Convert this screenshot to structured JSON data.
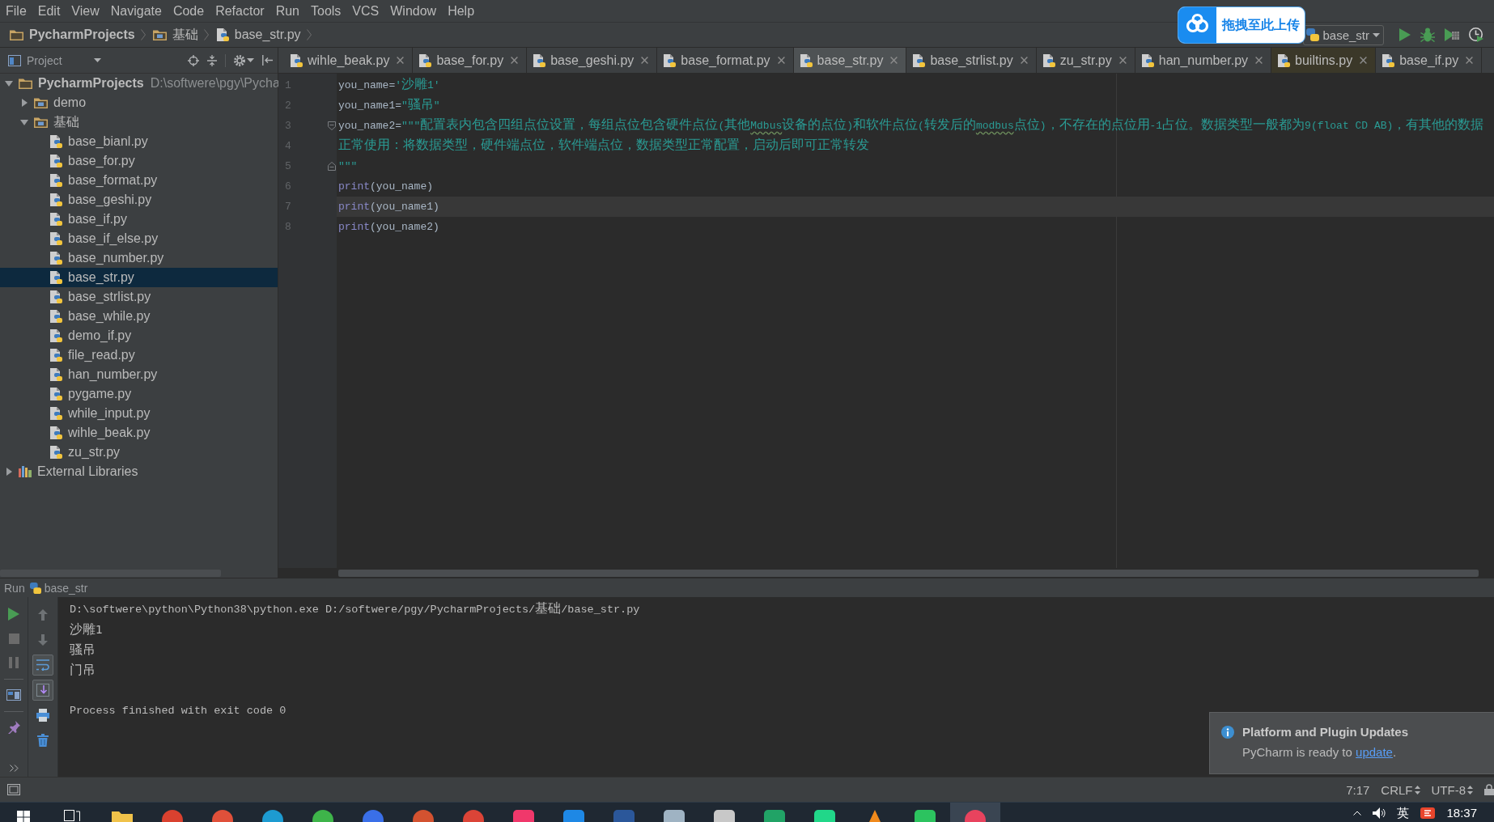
{
  "menu_bar": {
    "items": [
      "File",
      "Edit",
      "View",
      "Navigate",
      "Code",
      "Refactor",
      "Run",
      "Tools",
      "VCS",
      "Window",
      "Help"
    ]
  },
  "nav_bar": {
    "breadcrumbs": [
      {
        "label": "PycharmProjects",
        "kind": "project"
      },
      {
        "label": "基础",
        "kind": "folder"
      },
      {
        "label": "base_str.py",
        "kind": "file"
      }
    ],
    "run_config": "base_str"
  },
  "upload_widget": {
    "label": "拖拽至此上传"
  },
  "project_panel": {
    "title": "Project",
    "tree": [
      {
        "label": "PycharmProjects",
        "path": "D:\\softwere\\pgy\\Pycha",
        "kind": "project",
        "expanded": true,
        "selected": false,
        "children": [
          {
            "label": "demo",
            "kind": "folder",
            "expanded": false,
            "selected": false
          },
          {
            "label": "基础",
            "kind": "folder",
            "expanded": true,
            "selected": false,
            "children": [
              {
                "label": "base_bianl.py",
                "kind": "file",
                "selected": false
              },
              {
                "label": "base_for.py",
                "kind": "file",
                "selected": false
              },
              {
                "label": "base_format.py",
                "kind": "file",
                "selected": false
              },
              {
                "label": "base_geshi.py",
                "kind": "file",
                "selected": false
              },
              {
                "label": "base_if.py",
                "kind": "file",
                "selected": false
              },
              {
                "label": "base_if_else.py",
                "kind": "file",
                "selected": false
              },
              {
                "label": "base_number.py",
                "kind": "file",
                "selected": false
              },
              {
                "label": "base_str.py",
                "kind": "file",
                "selected": true
              },
              {
                "label": "base_strlist.py",
                "kind": "file",
                "selected": false
              },
              {
                "label": "base_while.py",
                "kind": "file",
                "selected": false
              },
              {
                "label": "demo_if.py",
                "kind": "file",
                "selected": false
              },
              {
                "label": "file_read.py",
                "kind": "file",
                "selected": false
              },
              {
                "label": "han_number.py",
                "kind": "file",
                "selected": false
              },
              {
                "label": "pygame.py",
                "kind": "file",
                "selected": false
              },
              {
                "label": "while_input.py",
                "kind": "file",
                "selected": false
              },
              {
                "label": "wihle_beak.py",
                "kind": "file",
                "selected": false
              },
              {
                "label": "zu_str.py",
                "kind": "file",
                "selected": false
              }
            ]
          }
        ]
      },
      {
        "label": "External Libraries",
        "kind": "library",
        "expanded": false,
        "selected": false
      }
    ]
  },
  "editor": {
    "tabs": [
      {
        "label": "wihle_beak.py",
        "kind": "project",
        "selected": false
      },
      {
        "label": "base_for.py",
        "kind": "project",
        "selected": false
      },
      {
        "label": "base_geshi.py",
        "kind": "project",
        "selected": false
      },
      {
        "label": "base_format.py",
        "kind": "project",
        "selected": false
      },
      {
        "label": "base_str.py",
        "kind": "project",
        "selected": true
      },
      {
        "label": "base_strlist.py",
        "kind": "project",
        "selected": false
      },
      {
        "label": "zu_str.py",
        "kind": "project",
        "selected": false
      },
      {
        "label": "han_number.py",
        "kind": "project",
        "selected": false
      },
      {
        "label": "builtins.py",
        "kind": "library",
        "selected": false
      },
      {
        "label": "base_if.py",
        "kind": "project",
        "selected": false
      }
    ],
    "lines": [
      {
        "number": "1",
        "current": false,
        "fold_start": false,
        "fold_end": false,
        "tokens": [
          {
            "text": "you_name=",
            "kind": "plain"
          },
          {
            "text": "'沙雕1'",
            "kind": "string"
          }
        ]
      },
      {
        "number": "2",
        "current": false,
        "fold_start": false,
        "fold_end": false,
        "tokens": [
          {
            "text": "you_name1=",
            "kind": "plain"
          },
          {
            "text": "\"骚吊\"",
            "kind": "string"
          }
        ]
      },
      {
        "number": "3",
        "current": false,
        "fold_start": true,
        "fold_end": false,
        "tokens": [
          {
            "text": "you_name2=",
            "kind": "plain"
          },
          {
            "text": "\"\"\"配置表内包含四组点位设置，每组点位包含硬件点位(其他",
            "kind": "string"
          },
          {
            "text": "Mdbus",
            "kind": "typo"
          },
          {
            "text": "设备的点位)和软件点位(转发后的",
            "kind": "string"
          },
          {
            "text": "modbus",
            "kind": "typo"
          },
          {
            "text": "点位)，不存在的点位用-1占位。数据类型一般都为9(float CD AB)，有其他的数据",
            "kind": "string"
          }
        ]
      },
      {
        "number": "4",
        "current": false,
        "fold_start": false,
        "fold_end": false,
        "tokens": [
          {
            "text": "正常使用：将数据类型，硬件端点位，软件端点位，数据类型正常配置，启动后即可正常转发",
            "kind": "string"
          }
        ]
      },
      {
        "number": "5",
        "current": false,
        "fold_start": false,
        "fold_end": true,
        "tokens": [
          {
            "text": "\"\"\"",
            "kind": "string"
          }
        ]
      },
      {
        "number": "6",
        "current": false,
        "fold_start": false,
        "fold_end": false,
        "tokens": [
          {
            "text": "print",
            "kind": "builtin"
          },
          {
            "text": "(you_name)",
            "kind": "plain"
          }
        ]
      },
      {
        "number": "7",
        "current": true,
        "fold_start": false,
        "fold_end": false,
        "tokens": [
          {
            "text": "print",
            "kind": "builtin"
          },
          {
            "text": "(you_name1)",
            "kind": "plain"
          }
        ]
      },
      {
        "number": "8",
        "current": false,
        "fold_start": false,
        "fold_end": false,
        "tokens": [
          {
            "text": "print",
            "kind": "builtin"
          },
          {
            "text": "(you_name2)",
            "kind": "plain"
          }
        ]
      }
    ]
  },
  "run_panel": {
    "title": "Run",
    "config": "base_str",
    "toolbar": {
      "stop_enabled": false,
      "pause_enabled": false,
      "soft_wrap": true,
      "scroll_to_end": true
    },
    "console": [
      {
        "text": "D:\\softwere\\python\\Python38\\python.exe D:/softwere/pgy/PycharmProjects/基础/base_str.py",
        "kind": "command"
      },
      {
        "text": "沙雕1",
        "kind": "output"
      },
      {
        "text": "骚吊",
        "kind": "output"
      },
      {
        "text": "门吊",
        "kind": "output"
      },
      {
        "text": "Process finished with exit code 0",
        "kind": "exit"
      }
    ]
  },
  "notification": {
    "title": "Platform and Plugin Updates",
    "text": "PyCharm is ready to",
    "link": "update",
    "end": "."
  },
  "status_bar": {
    "position": "7:17",
    "line_separator": "CRLF",
    "encoding": "UTF-8"
  },
  "taskbar": {
    "apps": [
      {
        "active": false
      },
      {
        "active": false
      },
      {
        "active": false
      },
      {
        "active": false
      },
      {
        "active": false
      },
      {
        "active": false
      },
      {
        "active": false
      },
      {
        "active": false
      },
      {
        "active": false
      },
      {
        "active": false
      },
      {
        "active": false
      },
      {
        "active": false
      },
      {
        "active": false
      },
      {
        "active": false
      },
      {
        "active": false
      },
      {
        "active": false
      },
      {
        "active": false
      },
      {
        "active": true
      }
    ],
    "ime": "英",
    "time": "18:37"
  }
}
